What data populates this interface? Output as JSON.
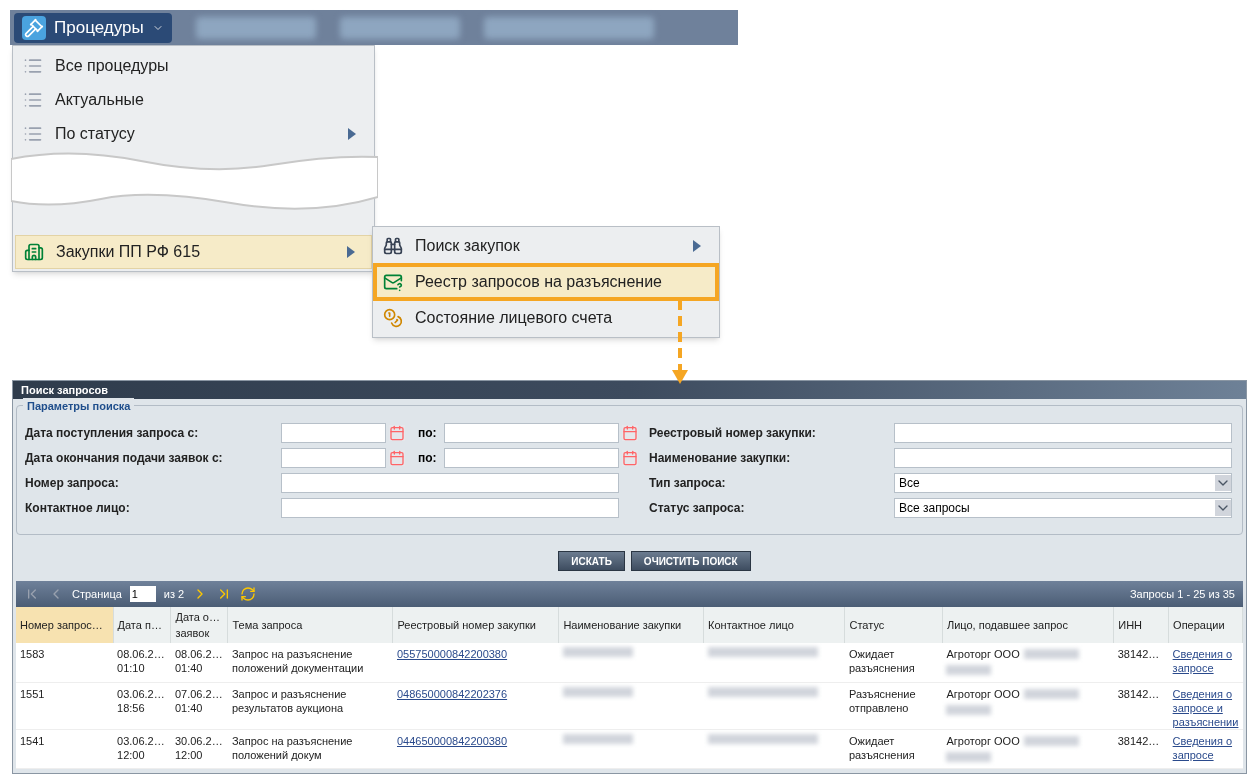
{
  "toolbar": {
    "menu_button": "Процедуры"
  },
  "menu": {
    "items": [
      {
        "label": "Все процедуры",
        "kind": "list",
        "has_submenu": false,
        "selected": false
      },
      {
        "label": "Актуальные",
        "kind": "list",
        "has_submenu": false,
        "selected": false
      },
      {
        "label": "По статусу",
        "kind": "list",
        "has_submenu": true,
        "selected": false
      },
      {
        "label": "Закупки ПП РФ 615",
        "kind": "building",
        "has_submenu": true,
        "selected": true
      }
    ]
  },
  "submenu": {
    "items": [
      {
        "label": "Поиск закупок",
        "kind": "binoculars",
        "has_submenu": true,
        "selected": false
      },
      {
        "label": "Реестр запросов на разъяснение",
        "kind": "envelope",
        "has_submenu": false,
        "selected": true
      },
      {
        "label": "Состояние лицевого счета",
        "kind": "coins",
        "has_submenu": false,
        "selected": false
      }
    ]
  },
  "panel": {
    "title": "Поиск запросов",
    "fieldset": "Параметры поиска",
    "left_fields": [
      {
        "label": "Дата поступления запроса с:",
        "kind": "date_range",
        "to_label": "по:"
      },
      {
        "label": "Дата окончания подачи заявок с:",
        "kind": "date_range",
        "to_label": "по:"
      },
      {
        "label": "Номер запроса:",
        "kind": "text"
      },
      {
        "label": "Контактное лицо:",
        "kind": "text"
      }
    ],
    "right_fields": [
      {
        "label": "Реестровый номер закупки:",
        "kind": "text"
      },
      {
        "label": "Наименование закупки:",
        "kind": "text"
      },
      {
        "label": "Тип запроса:",
        "kind": "select",
        "value": "Все"
      },
      {
        "label": "Статус запроса:",
        "kind": "select",
        "value": "Все запросы"
      }
    ],
    "buttons": [
      "ИСКАТЬ",
      "ОЧИСТИТЬ ПОИСК"
    ]
  },
  "pager": {
    "page_label": "Страница",
    "page": "1",
    "of": "из 2",
    "summary": "Запросы 1 - 25 из 35"
  },
  "table": {
    "columns": [
      {
        "label": "Номер запрос…",
        "sorted": true
      },
      {
        "label": "Дата п…",
        "sorted": false
      },
      {
        "label": "Дата о…\nзаявок",
        "sorted": false
      },
      {
        "label": "Тема запроса",
        "sorted": false
      },
      {
        "label": "Реестровый номер закупки",
        "sorted": false
      },
      {
        "label": "Наименование закупки",
        "sorted": false
      },
      {
        "label": "Контактное лицо",
        "sorted": false
      },
      {
        "label": "Статус",
        "sorted": false
      },
      {
        "label": "Лицо, подавшее запрос",
        "sorted": false
      },
      {
        "label": "ИНН",
        "sorted": false
      },
      {
        "label": "Операции",
        "sorted": false
      }
    ],
    "rows": [
      {
        "number": "1583",
        "submitted": "08.06.2…\n01:10",
        "deadline": "08.06.2…\n01:40",
        "topic": "Запрос на разъяснение\nположений документации",
        "registry_number": "055750000842200380",
        "status": "Ожидает\nразъяснения",
        "requester": "Агроторг ООО",
        "inn": "38142…",
        "operation": "Сведения о\nзапросе"
      },
      {
        "number": "1551",
        "submitted": "03.06.2…\n18:56",
        "deadline": "07.06.2…\n01:40",
        "topic": "Запрос и разъяснение\nрезультатов аукциона",
        "registry_number": "048650000842202376",
        "status": "Разъяснение\nотправлено",
        "requester": "Агроторг ООО",
        "inn": "38142…",
        "operation": "Сведения о\nзапросе и\nразъяснении"
      },
      {
        "number": "1541",
        "submitted": "03.06.2…\n12:00",
        "deadline": "30.06.2…\n12:00",
        "topic": "Запрос на разъяснение\nположений докум",
        "registry_number": "044650000842200380",
        "status": "Ожидает\nразъяснения",
        "requester": "Агроторг ООО",
        "inn": "38142…",
        "operation": "Сведения о\nзапросе"
      }
    ]
  }
}
